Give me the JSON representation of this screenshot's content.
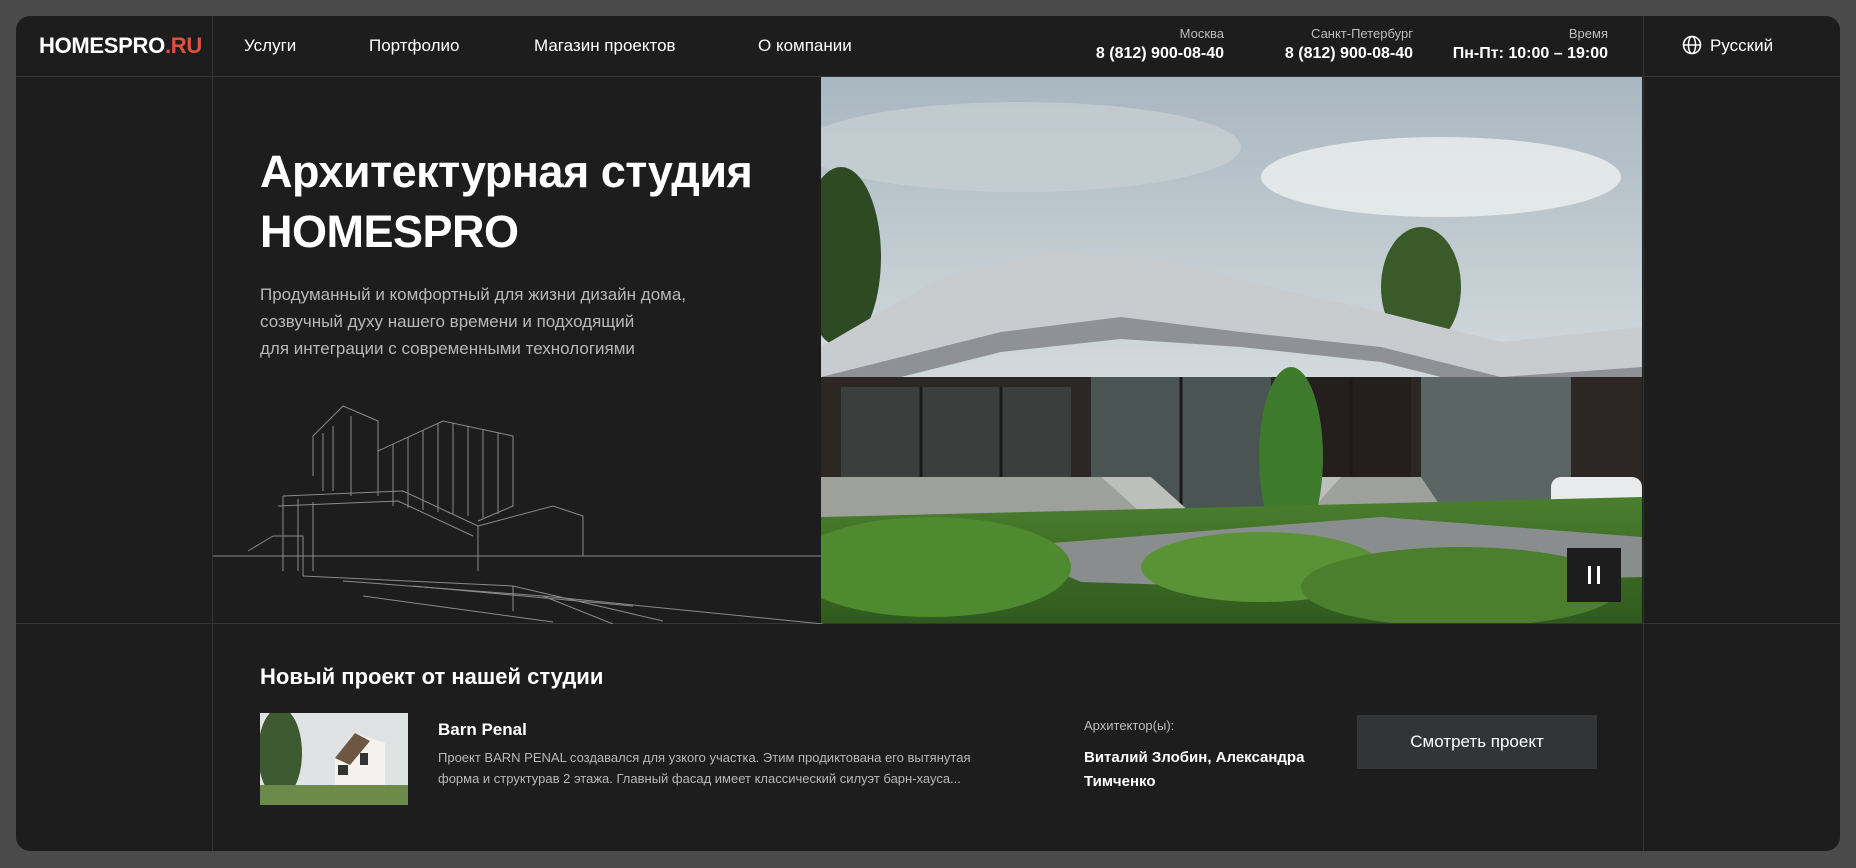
{
  "header": {
    "logo_main": "HOMESPRO",
    "logo_accent": ".RU",
    "nav": [
      "Услуги",
      "Портфолио",
      "Магазин проектов",
      "О компании"
    ],
    "contacts": [
      {
        "label": "Москва",
        "value": "8 (812) 900-08-40"
      },
      {
        "label": "Санкт-Петербург",
        "value": "8 (812) 900-08-40"
      },
      {
        "label": "Время",
        "value": "Пн-Пт: 10:00 – 19:00"
      }
    ],
    "language": "Русский",
    "language_icon": "globe-icon"
  },
  "hero": {
    "title_lines": [
      "Архитектурная студия",
      "HOMESPRO"
    ],
    "description_lines": [
      "Продуманный и комфортный для жизни дизайн дома,",
      "созвучный духу нашего времени и подходящий",
      "для интеграции с современными технологиями"
    ],
    "pause_icon": "pause-icon"
  },
  "new_project": {
    "heading": "Новый проект от нашей студии",
    "name": "Barn Penal",
    "description_lines": [
      "Проект BARN PENAL создавался для узкого участка. Этим продиктована его вытянутая",
      "форма и структурав 2 этажа. Главный фасад имеет классический силуэт барн-хауса..."
    ],
    "architects_label": "Архитектор(ы):",
    "architects_lines": [
      "Виталий Злобин, Александра",
      "Тимченко"
    ],
    "button_label": "Смотреть проект"
  },
  "colors": {
    "background": "#1d1d1e",
    "accent": "#e0503c",
    "button": "#333436"
  }
}
